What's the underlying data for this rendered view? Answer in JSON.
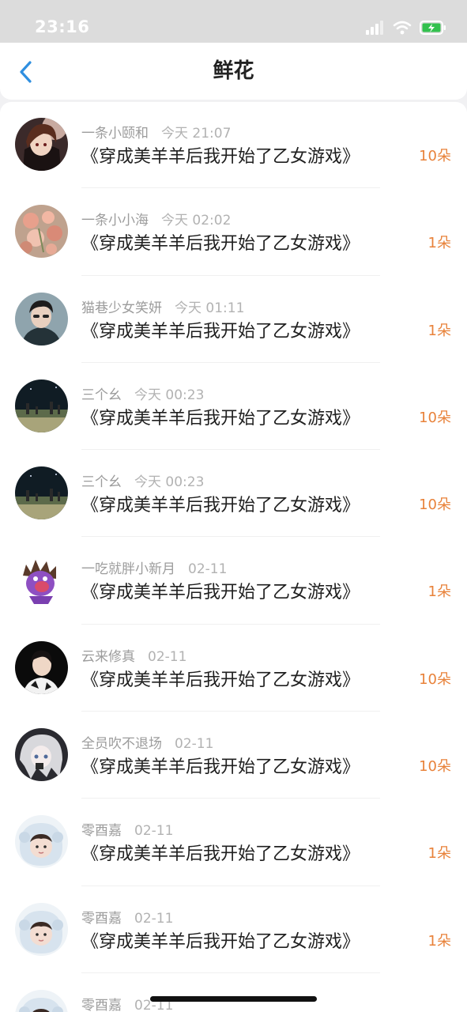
{
  "status_bar": {
    "time": "23:16",
    "icons": [
      "signal-icon",
      "wifi-icon",
      "battery-charging-icon"
    ]
  },
  "header": {
    "title": "鲜花",
    "back_icon": "chevron-left-icon"
  },
  "colors": {
    "accent_blue": "#2f8fe0",
    "count_orange": "#e8823a",
    "battery_green": "#33c14e"
  },
  "records": [
    {
      "user": "一条小颐和",
      "time": "今天 21:07",
      "book": "《穿成美羊羊后我开始了乙女游戏》",
      "count": "10朵",
      "avatar": "avatar-anime-boy"
    },
    {
      "user": "一条小小海",
      "time": "今天 02:02",
      "book": "《穿成美羊羊后我开始了乙女游戏》",
      "count": "1朵",
      "avatar": "avatar-flowers"
    },
    {
      "user": "猫巷少女笑妍",
      "time": "今天 01:11",
      "book": "《穿成美羊羊后我开始了乙女游戏》",
      "count": "1朵",
      "avatar": "avatar-young-man"
    },
    {
      "user": "三个幺",
      "time": "今天 00:23",
      "book": "《穿成美羊羊后我开始了乙女游戏》",
      "count": "10朵",
      "avatar": "avatar-night-field"
    },
    {
      "user": "三个幺",
      "time": "今天 00:23",
      "book": "《穿成美羊羊后我开始了乙女游戏》",
      "count": "10朵",
      "avatar": "avatar-night-field"
    },
    {
      "user": "一吃就胖小新月",
      "time": "02-11",
      "book": "《穿成美羊羊后我开始了乙女游戏》",
      "count": "1朵",
      "avatar": "avatar-purple-creature"
    },
    {
      "user": "云来修真",
      "time": "02-11",
      "book": "《穿成美羊羊后我开始了乙女游戏》",
      "count": "10朵",
      "avatar": "avatar-dark-boy"
    },
    {
      "user": "全员吹不退场",
      "time": "02-11",
      "book": "《穿成美羊羊后我开始了乙女游戏》",
      "count": "10朵",
      "avatar": "avatar-white-hair-anime"
    },
    {
      "user": "零酉嘉",
      "time": "02-11",
      "book": "《穿成美羊羊后我开始了乙女游戏》",
      "count": "1朵",
      "avatar": "avatar-cute-hood"
    },
    {
      "user": "零酉嘉",
      "time": "02-11",
      "book": "《穿成美羊羊后我开始了乙女游戏》",
      "count": "1朵",
      "avatar": "avatar-cute-hood"
    },
    {
      "user": "零酉嘉",
      "time": "02-11",
      "book": "",
      "count": "",
      "avatar": "avatar-cute-hood"
    }
  ]
}
